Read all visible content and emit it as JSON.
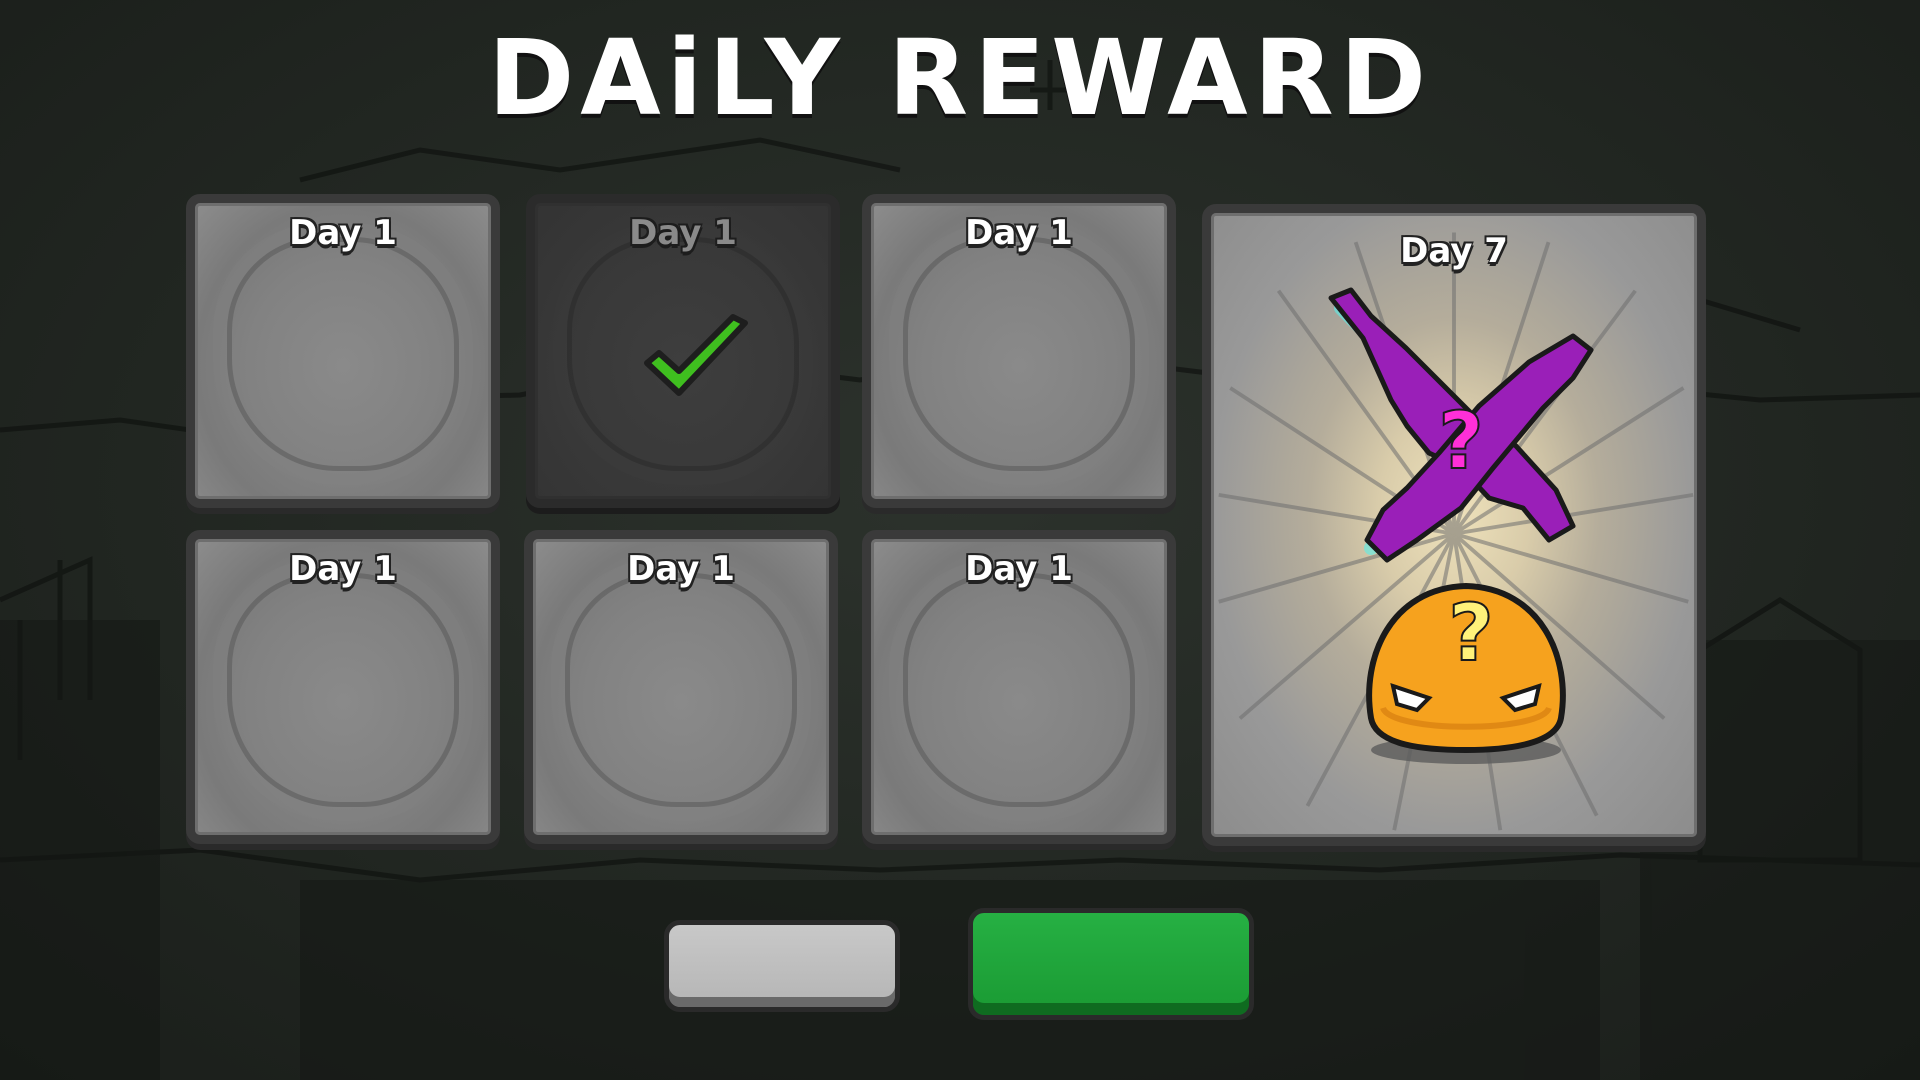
{
  "title": "DAiLY REWARD",
  "cards": [
    {
      "label": "Day 1",
      "state": "locked"
    },
    {
      "label": "Day 1",
      "state": "claimed"
    },
    {
      "label": "Day 1",
      "state": "locked"
    },
    {
      "label": "Day 1",
      "state": "locked"
    },
    {
      "label": "Day 1",
      "state": "locked"
    },
    {
      "label": "Day 1",
      "state": "locked"
    }
  ],
  "big_card": {
    "label": "Day 7",
    "reward_icons": [
      "mystery-weapon-icon",
      "mystery-character-icon"
    ]
  },
  "buttons": {
    "secondary_label": "",
    "primary_label": ""
  },
  "colors": {
    "claimed_check": "#3fbf1f",
    "mystery_weapon": "#9a1fb8",
    "mystery_character": "#f6a21e",
    "primary_button": "#1f9f38",
    "secondary_button": "#bdbdbd"
  }
}
